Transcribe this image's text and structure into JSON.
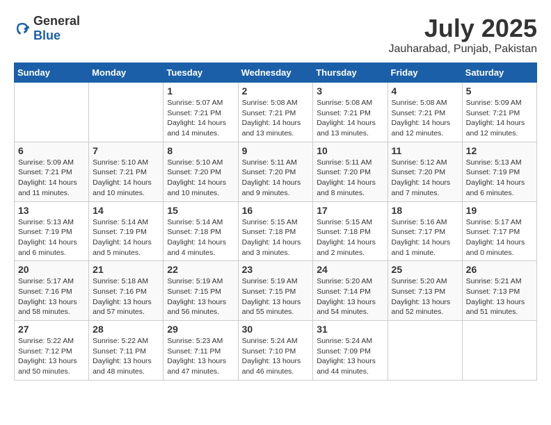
{
  "header": {
    "logo_general": "General",
    "logo_blue": "Blue",
    "month_year": "July 2025",
    "location": "Jauharabad, Punjab, Pakistan"
  },
  "days_of_week": [
    "Sunday",
    "Monday",
    "Tuesday",
    "Wednesday",
    "Thursday",
    "Friday",
    "Saturday"
  ],
  "weeks": [
    [
      {
        "day": "",
        "info": ""
      },
      {
        "day": "",
        "info": ""
      },
      {
        "day": "1",
        "info": "Sunrise: 5:07 AM\nSunset: 7:21 PM\nDaylight: 14 hours and 14 minutes."
      },
      {
        "day": "2",
        "info": "Sunrise: 5:08 AM\nSunset: 7:21 PM\nDaylight: 14 hours and 13 minutes."
      },
      {
        "day": "3",
        "info": "Sunrise: 5:08 AM\nSunset: 7:21 PM\nDaylight: 14 hours and 13 minutes."
      },
      {
        "day": "4",
        "info": "Sunrise: 5:08 AM\nSunset: 7:21 PM\nDaylight: 14 hours and 12 minutes."
      },
      {
        "day": "5",
        "info": "Sunrise: 5:09 AM\nSunset: 7:21 PM\nDaylight: 14 hours and 12 minutes."
      }
    ],
    [
      {
        "day": "6",
        "info": "Sunrise: 5:09 AM\nSunset: 7:21 PM\nDaylight: 14 hours and 11 minutes."
      },
      {
        "day": "7",
        "info": "Sunrise: 5:10 AM\nSunset: 7:21 PM\nDaylight: 14 hours and 10 minutes."
      },
      {
        "day": "8",
        "info": "Sunrise: 5:10 AM\nSunset: 7:20 PM\nDaylight: 14 hours and 10 minutes."
      },
      {
        "day": "9",
        "info": "Sunrise: 5:11 AM\nSunset: 7:20 PM\nDaylight: 14 hours and 9 minutes."
      },
      {
        "day": "10",
        "info": "Sunrise: 5:11 AM\nSunset: 7:20 PM\nDaylight: 14 hours and 8 minutes."
      },
      {
        "day": "11",
        "info": "Sunrise: 5:12 AM\nSunset: 7:20 PM\nDaylight: 14 hours and 7 minutes."
      },
      {
        "day": "12",
        "info": "Sunrise: 5:13 AM\nSunset: 7:19 PM\nDaylight: 14 hours and 6 minutes."
      }
    ],
    [
      {
        "day": "13",
        "info": "Sunrise: 5:13 AM\nSunset: 7:19 PM\nDaylight: 14 hours and 6 minutes."
      },
      {
        "day": "14",
        "info": "Sunrise: 5:14 AM\nSunset: 7:19 PM\nDaylight: 14 hours and 5 minutes."
      },
      {
        "day": "15",
        "info": "Sunrise: 5:14 AM\nSunset: 7:18 PM\nDaylight: 14 hours and 4 minutes."
      },
      {
        "day": "16",
        "info": "Sunrise: 5:15 AM\nSunset: 7:18 PM\nDaylight: 14 hours and 3 minutes."
      },
      {
        "day": "17",
        "info": "Sunrise: 5:15 AM\nSunset: 7:18 PM\nDaylight: 14 hours and 2 minutes."
      },
      {
        "day": "18",
        "info": "Sunrise: 5:16 AM\nSunset: 7:17 PM\nDaylight: 14 hours and 1 minute."
      },
      {
        "day": "19",
        "info": "Sunrise: 5:17 AM\nSunset: 7:17 PM\nDaylight: 14 hours and 0 minutes."
      }
    ],
    [
      {
        "day": "20",
        "info": "Sunrise: 5:17 AM\nSunset: 7:16 PM\nDaylight: 13 hours and 58 minutes."
      },
      {
        "day": "21",
        "info": "Sunrise: 5:18 AM\nSunset: 7:16 PM\nDaylight: 13 hours and 57 minutes."
      },
      {
        "day": "22",
        "info": "Sunrise: 5:19 AM\nSunset: 7:15 PM\nDaylight: 13 hours and 56 minutes."
      },
      {
        "day": "23",
        "info": "Sunrise: 5:19 AM\nSunset: 7:15 PM\nDaylight: 13 hours and 55 minutes."
      },
      {
        "day": "24",
        "info": "Sunrise: 5:20 AM\nSunset: 7:14 PM\nDaylight: 13 hours and 54 minutes."
      },
      {
        "day": "25",
        "info": "Sunrise: 5:20 AM\nSunset: 7:13 PM\nDaylight: 13 hours and 52 minutes."
      },
      {
        "day": "26",
        "info": "Sunrise: 5:21 AM\nSunset: 7:13 PM\nDaylight: 13 hours and 51 minutes."
      }
    ],
    [
      {
        "day": "27",
        "info": "Sunrise: 5:22 AM\nSunset: 7:12 PM\nDaylight: 13 hours and 50 minutes."
      },
      {
        "day": "28",
        "info": "Sunrise: 5:22 AM\nSunset: 7:11 PM\nDaylight: 13 hours and 48 minutes."
      },
      {
        "day": "29",
        "info": "Sunrise: 5:23 AM\nSunset: 7:11 PM\nDaylight: 13 hours and 47 minutes."
      },
      {
        "day": "30",
        "info": "Sunrise: 5:24 AM\nSunset: 7:10 PM\nDaylight: 13 hours and 46 minutes."
      },
      {
        "day": "31",
        "info": "Sunrise: 5:24 AM\nSunset: 7:09 PM\nDaylight: 13 hours and 44 minutes."
      },
      {
        "day": "",
        "info": ""
      },
      {
        "day": "",
        "info": ""
      }
    ]
  ]
}
